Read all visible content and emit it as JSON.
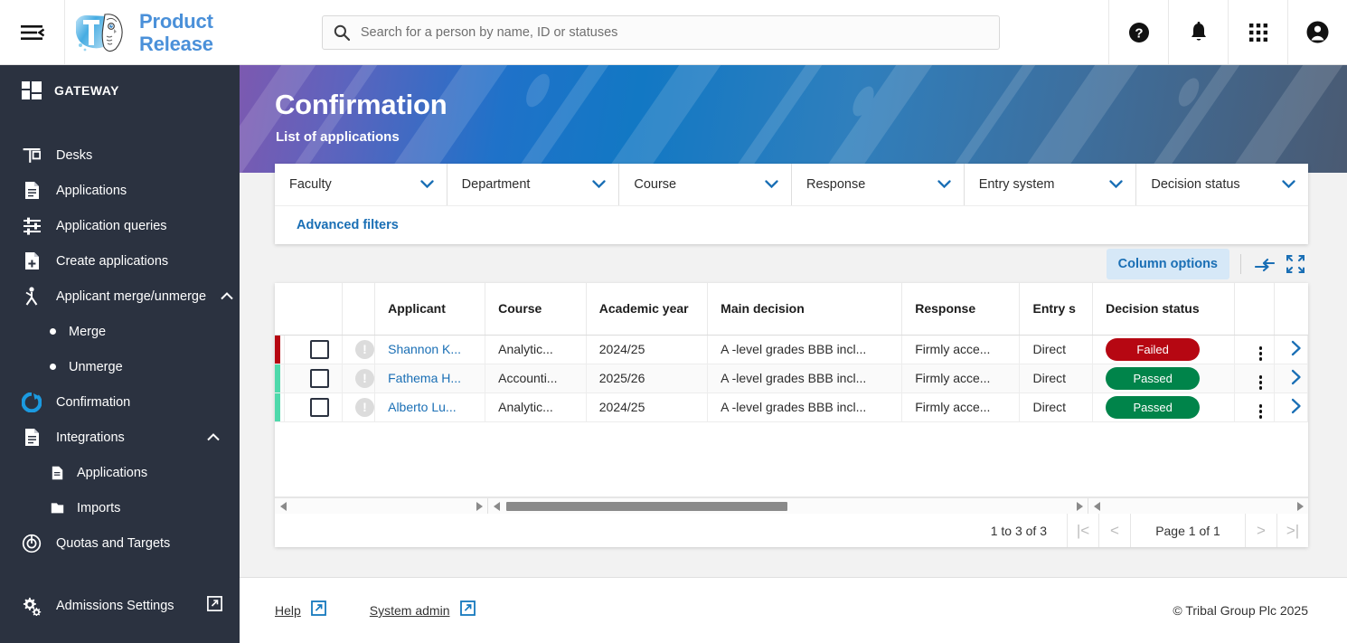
{
  "topbar": {
    "menu_icon": "hamburger-menu-icon",
    "brand_line1": "Product",
    "brand_line2": "Release",
    "search_placeholder": "Search for a person by name, ID or statuses",
    "search_value": "",
    "icons": [
      "help-icon",
      "notifications-bell-icon",
      "apps-grid-icon",
      "account-avatar-icon"
    ]
  },
  "sidebar": {
    "logo_label": "GATEWAY",
    "items": [
      {
        "label": "Desks",
        "icon": "desks-icon",
        "type": "item"
      },
      {
        "label": "Applications",
        "icon": "document-icon",
        "type": "item"
      },
      {
        "label": "Application queries",
        "icon": "filter-sliders-icon",
        "type": "item"
      },
      {
        "label": "Create applications",
        "icon": "document-plus-icon",
        "type": "item"
      },
      {
        "label": "Applicant merge/unmerge",
        "icon": "merge-person-icon",
        "type": "expandable",
        "expanded": true
      },
      {
        "label": "Merge",
        "icon": "bullet-dot-icon",
        "type": "sub"
      },
      {
        "label": "Unmerge",
        "icon": "bullet-dot-icon",
        "type": "sub"
      },
      {
        "label": "Confirmation",
        "icon": "confirmation-icon",
        "type": "item",
        "active": true
      },
      {
        "label": "Integrations",
        "icon": "document-icon",
        "type": "expandable",
        "expanded": true
      },
      {
        "label": "Applications",
        "icon": "document-small-icon",
        "type": "sub2"
      },
      {
        "label": "Imports",
        "icon": "imports-folder-icon",
        "type": "sub2"
      },
      {
        "label": "Quotas and Targets",
        "icon": "target-icon",
        "type": "item"
      }
    ],
    "bottom_item": {
      "label": "Admissions Settings",
      "icon": "gears-icon",
      "external_icon": "external-link-icon"
    }
  },
  "banner": {
    "title": "Confirmation",
    "subtitle": "List of applications"
  },
  "filters": {
    "dropdowns": [
      {
        "label": "Faculty",
        "value": ""
      },
      {
        "label": "Department",
        "value": ""
      },
      {
        "label": "Course",
        "value": ""
      },
      {
        "label": "Response",
        "value": ""
      },
      {
        "label": "Entry system",
        "value": ""
      },
      {
        "label": "Decision status",
        "value": ""
      }
    ],
    "advanced_label": "Advanced filters"
  },
  "toolbar": {
    "column_options_label": "Column options",
    "icons": [
      "collapse-left-icon",
      "fit-screen-icon"
    ]
  },
  "table": {
    "columns": [
      "",
      "",
      "Applicant",
      "Course",
      "Academic year",
      "Main decision",
      "Response",
      "Entry s",
      "Decision status",
      "",
      ""
    ],
    "rows": [
      {
        "marker_color": "#b60712",
        "checked": false,
        "warning": "!",
        "applicant": "Shannon K...",
        "course": "Analytic...",
        "academic_year": "2024/25",
        "main_decision": "A -level grades BBB incl...",
        "response": "Firmly acce...",
        "entry_system": "Direct",
        "decision_status": "Failed",
        "decision_status_type": "failed"
      },
      {
        "marker_color": "#4ed9ab",
        "checked": false,
        "warning": "!",
        "applicant": "Fathema H...",
        "course": "Accounti...",
        "academic_year": "2025/26",
        "main_decision": "A -level grades BBB incl...",
        "response": "Firmly acce...",
        "entry_system": "Direct",
        "decision_status": "Passed",
        "decision_status_type": "passed"
      },
      {
        "marker_color": "#4ed9ab",
        "checked": false,
        "warning": "!",
        "applicant": "Alberto Lu...",
        "course": "Analytic...",
        "academic_year": "2024/25",
        "main_decision": "A -level grades BBB incl...",
        "response": "Firmly acce...",
        "entry_system": "Direct",
        "decision_status": "Passed",
        "decision_status_type": "passed"
      }
    ]
  },
  "pager": {
    "count_text": "1 to 3 of 3",
    "first_label": "|<",
    "prev_label": "<",
    "page_label": "Page 1 of 1",
    "next_label": ">",
    "last_label": ">|"
  },
  "footer": {
    "help_label": "Help",
    "system_admin_label": "System admin",
    "copyright": "© Tribal Group Plc 2025"
  },
  "colors": {
    "accent_blue": "#1a6fb5",
    "sidebar_bg": "#2b3240",
    "pass_green": "#00844a",
    "fail_red": "#b60712",
    "marker_green": "#4ed9ab"
  }
}
